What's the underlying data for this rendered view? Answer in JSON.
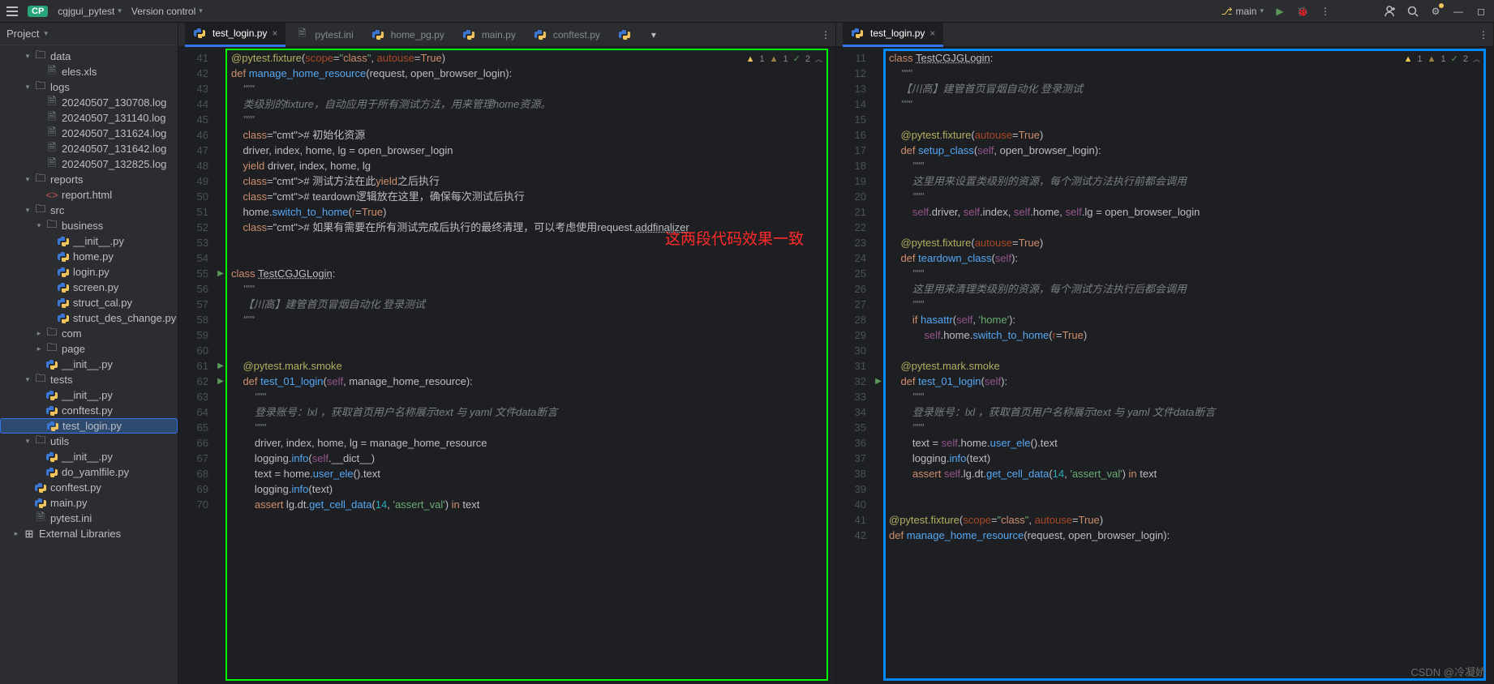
{
  "titlebar": {
    "project_badge": "CP",
    "project": "cgjgui_pytest",
    "vcs": "Version control",
    "branch": "main"
  },
  "sidebar": {
    "title": "Project",
    "tree": [
      {
        "d": 2,
        "e": "v",
        "i": "dir",
        "t": "data"
      },
      {
        "d": 3,
        "e": "",
        "i": "file",
        "t": "eles.xls"
      },
      {
        "d": 2,
        "e": "v",
        "i": "dir",
        "t": "logs"
      },
      {
        "d": 3,
        "e": "",
        "i": "file",
        "t": "20240507_130708.log"
      },
      {
        "d": 3,
        "e": "",
        "i": "file",
        "t": "20240507_131140.log"
      },
      {
        "d": 3,
        "e": "",
        "i": "file",
        "t": "20240507_131624.log"
      },
      {
        "d": 3,
        "e": "",
        "i": "file",
        "t": "20240507_131642.log"
      },
      {
        "d": 3,
        "e": "",
        "i": "file",
        "t": "20240507_132825.log"
      },
      {
        "d": 2,
        "e": "v",
        "i": "dir",
        "t": "reports"
      },
      {
        "d": 3,
        "e": "",
        "i": "html",
        "t": "report.html"
      },
      {
        "d": 2,
        "e": "v",
        "i": "dir",
        "t": "src"
      },
      {
        "d": 3,
        "e": "v",
        "i": "dir",
        "t": "business"
      },
      {
        "d": 4,
        "e": "",
        "i": "py",
        "t": "__init__.py"
      },
      {
        "d": 4,
        "e": "",
        "i": "py",
        "t": "home.py"
      },
      {
        "d": 4,
        "e": "",
        "i": "py",
        "t": "login.py"
      },
      {
        "d": 4,
        "e": "",
        "i": "py",
        "t": "screen.py"
      },
      {
        "d": 4,
        "e": "",
        "i": "py",
        "t": "struct_cal.py"
      },
      {
        "d": 4,
        "e": "",
        "i": "py",
        "t": "struct_des_change.py"
      },
      {
        "d": 3,
        "e": ">",
        "i": "dir",
        "t": "com"
      },
      {
        "d": 3,
        "e": ">",
        "i": "dir",
        "t": "page"
      },
      {
        "d": 3,
        "e": "",
        "i": "py",
        "t": "__init__.py"
      },
      {
        "d": 2,
        "e": "v",
        "i": "dir",
        "t": "tests"
      },
      {
        "d": 3,
        "e": "",
        "i": "py",
        "t": "__init__.py"
      },
      {
        "d": 3,
        "e": "",
        "i": "py",
        "t": "conftest.py"
      },
      {
        "d": 3,
        "e": "",
        "i": "py",
        "t": "test_login.py",
        "sel": true
      },
      {
        "d": 2,
        "e": "v",
        "i": "dir",
        "t": "utils"
      },
      {
        "d": 3,
        "e": "",
        "i": "py",
        "t": "__init__.py"
      },
      {
        "d": 3,
        "e": "",
        "i": "py",
        "t": "do_yamlfile.py"
      },
      {
        "d": 2,
        "e": "",
        "i": "py",
        "t": "conftest.py"
      },
      {
        "d": 2,
        "e": "",
        "i": "py",
        "t": "main.py"
      },
      {
        "d": 2,
        "e": "",
        "i": "file",
        "t": "pytest.ini"
      },
      {
        "d": 1,
        "e": ">",
        "i": "lib",
        "t": "External Libraries"
      }
    ]
  },
  "left_tabs": [
    {
      "t": "test_login.py",
      "i": "py",
      "active": true
    },
    {
      "t": "pytest.ini",
      "i": "file"
    },
    {
      "t": "home_pg.py",
      "i": "py"
    },
    {
      "t": "main.py",
      "i": "py"
    },
    {
      "t": "conftest.py",
      "i": "py"
    },
    {
      "t": "",
      "i": "py"
    }
  ],
  "right_tabs": [
    {
      "t": "test_login.py",
      "i": "py",
      "active": true
    }
  ],
  "inspections_left": {
    "warn": "1",
    "weak": "1",
    "ok": "2"
  },
  "inspections_right": {
    "warn": "1",
    "weak": "1",
    "ok": "2"
  },
  "left_start": 41,
  "left_code": [
    "@pytest.fixture(scope=\"class\", autouse=True)",
    "def manage_home_resource(request, open_browser_login):",
    "    \"\"\"",
    "    类级别的fixture，自动应用于所有测试方法，用来管理home资源。",
    "    \"\"\"",
    "    # 初始化资源",
    "    driver, index, home, lg = open_browser_login",
    "    yield driver, index, home, lg",
    "    # 测试方法在此yield之后执行",
    "    # teardown逻辑放在这里，确保每次测试后执行",
    "    home.switch_to_home(r=True)",
    "    # 如果有需要在所有测试完成后执行的最终清理，可以考虑使用request.addfinalizer",
    "",
    "",
    "class TestCGJGLogin:",
    "    \"\"\"",
    "    【川高】建管首页冒烟自动化 登录测试",
    "    \"\"\"",
    "",
    "",
    "    @pytest.mark.smoke",
    "    def test_01_login(self, manage_home_resource):",
    "        \"\"\"",
    "        登录账号：lxl ，获取首页用户名称展示text 与 yaml 文件data断言",
    "        \"\"\"",
    "        driver, index, home, lg = manage_home_resource",
    "        logging.info(self.__dict__)",
    "        text = home.user_ele().text",
    "        logging.info(text)",
    "        assert lg.dt.get_cell_data(14, 'assert_val') in text"
  ],
  "left_run": [
    15,
    21,
    22
  ],
  "right_start": 11,
  "right_code": [
    "class TestCGJGLogin:",
    "    \"\"\"",
    "    【川高】建管首页冒烟自动化 登录测试",
    "    \"\"\"",
    "",
    "    @pytest.fixture(autouse=True)",
    "    def setup_class(self, open_browser_login):",
    "        \"\"\"",
    "        这里用来设置类级别的资源，每个测试方法执行前都会调用",
    "        \"\"\"",
    "        self.driver, self.index, self.home, self.lg = open_browser_login",
    "",
    "    @pytest.fixture(autouse=True)",
    "    def teardown_class(self):",
    "        \"\"\"",
    "        这里用来清理类级别的资源，每个测试方法执行后都会调用",
    "        \"\"\"",
    "        if hasattr(self, 'home'):",
    "            self.home.switch_to_home(r=True)",
    "",
    "    @pytest.mark.smoke",
    "    def test_01_login(self):",
    "        \"\"\"",
    "        登录账号：lxl ，获取首页用户名称展示text 与 yaml 文件data断言",
    "        \"\"\"",
    "        text = self.home.user_ele().text",
    "        logging.info(text)",
    "        assert self.lg.dt.get_cell_data(14, 'assert_val') in text",
    "",
    "",
    "@pytest.fixture(scope=\"class\", autouse=True)",
    "def manage_home_resource(request, open_browser_login):"
  ],
  "right_run": [
    22
  ],
  "annotation": "这两段代码效果一致",
  "watermark": "CSDN @冷凝娇"
}
